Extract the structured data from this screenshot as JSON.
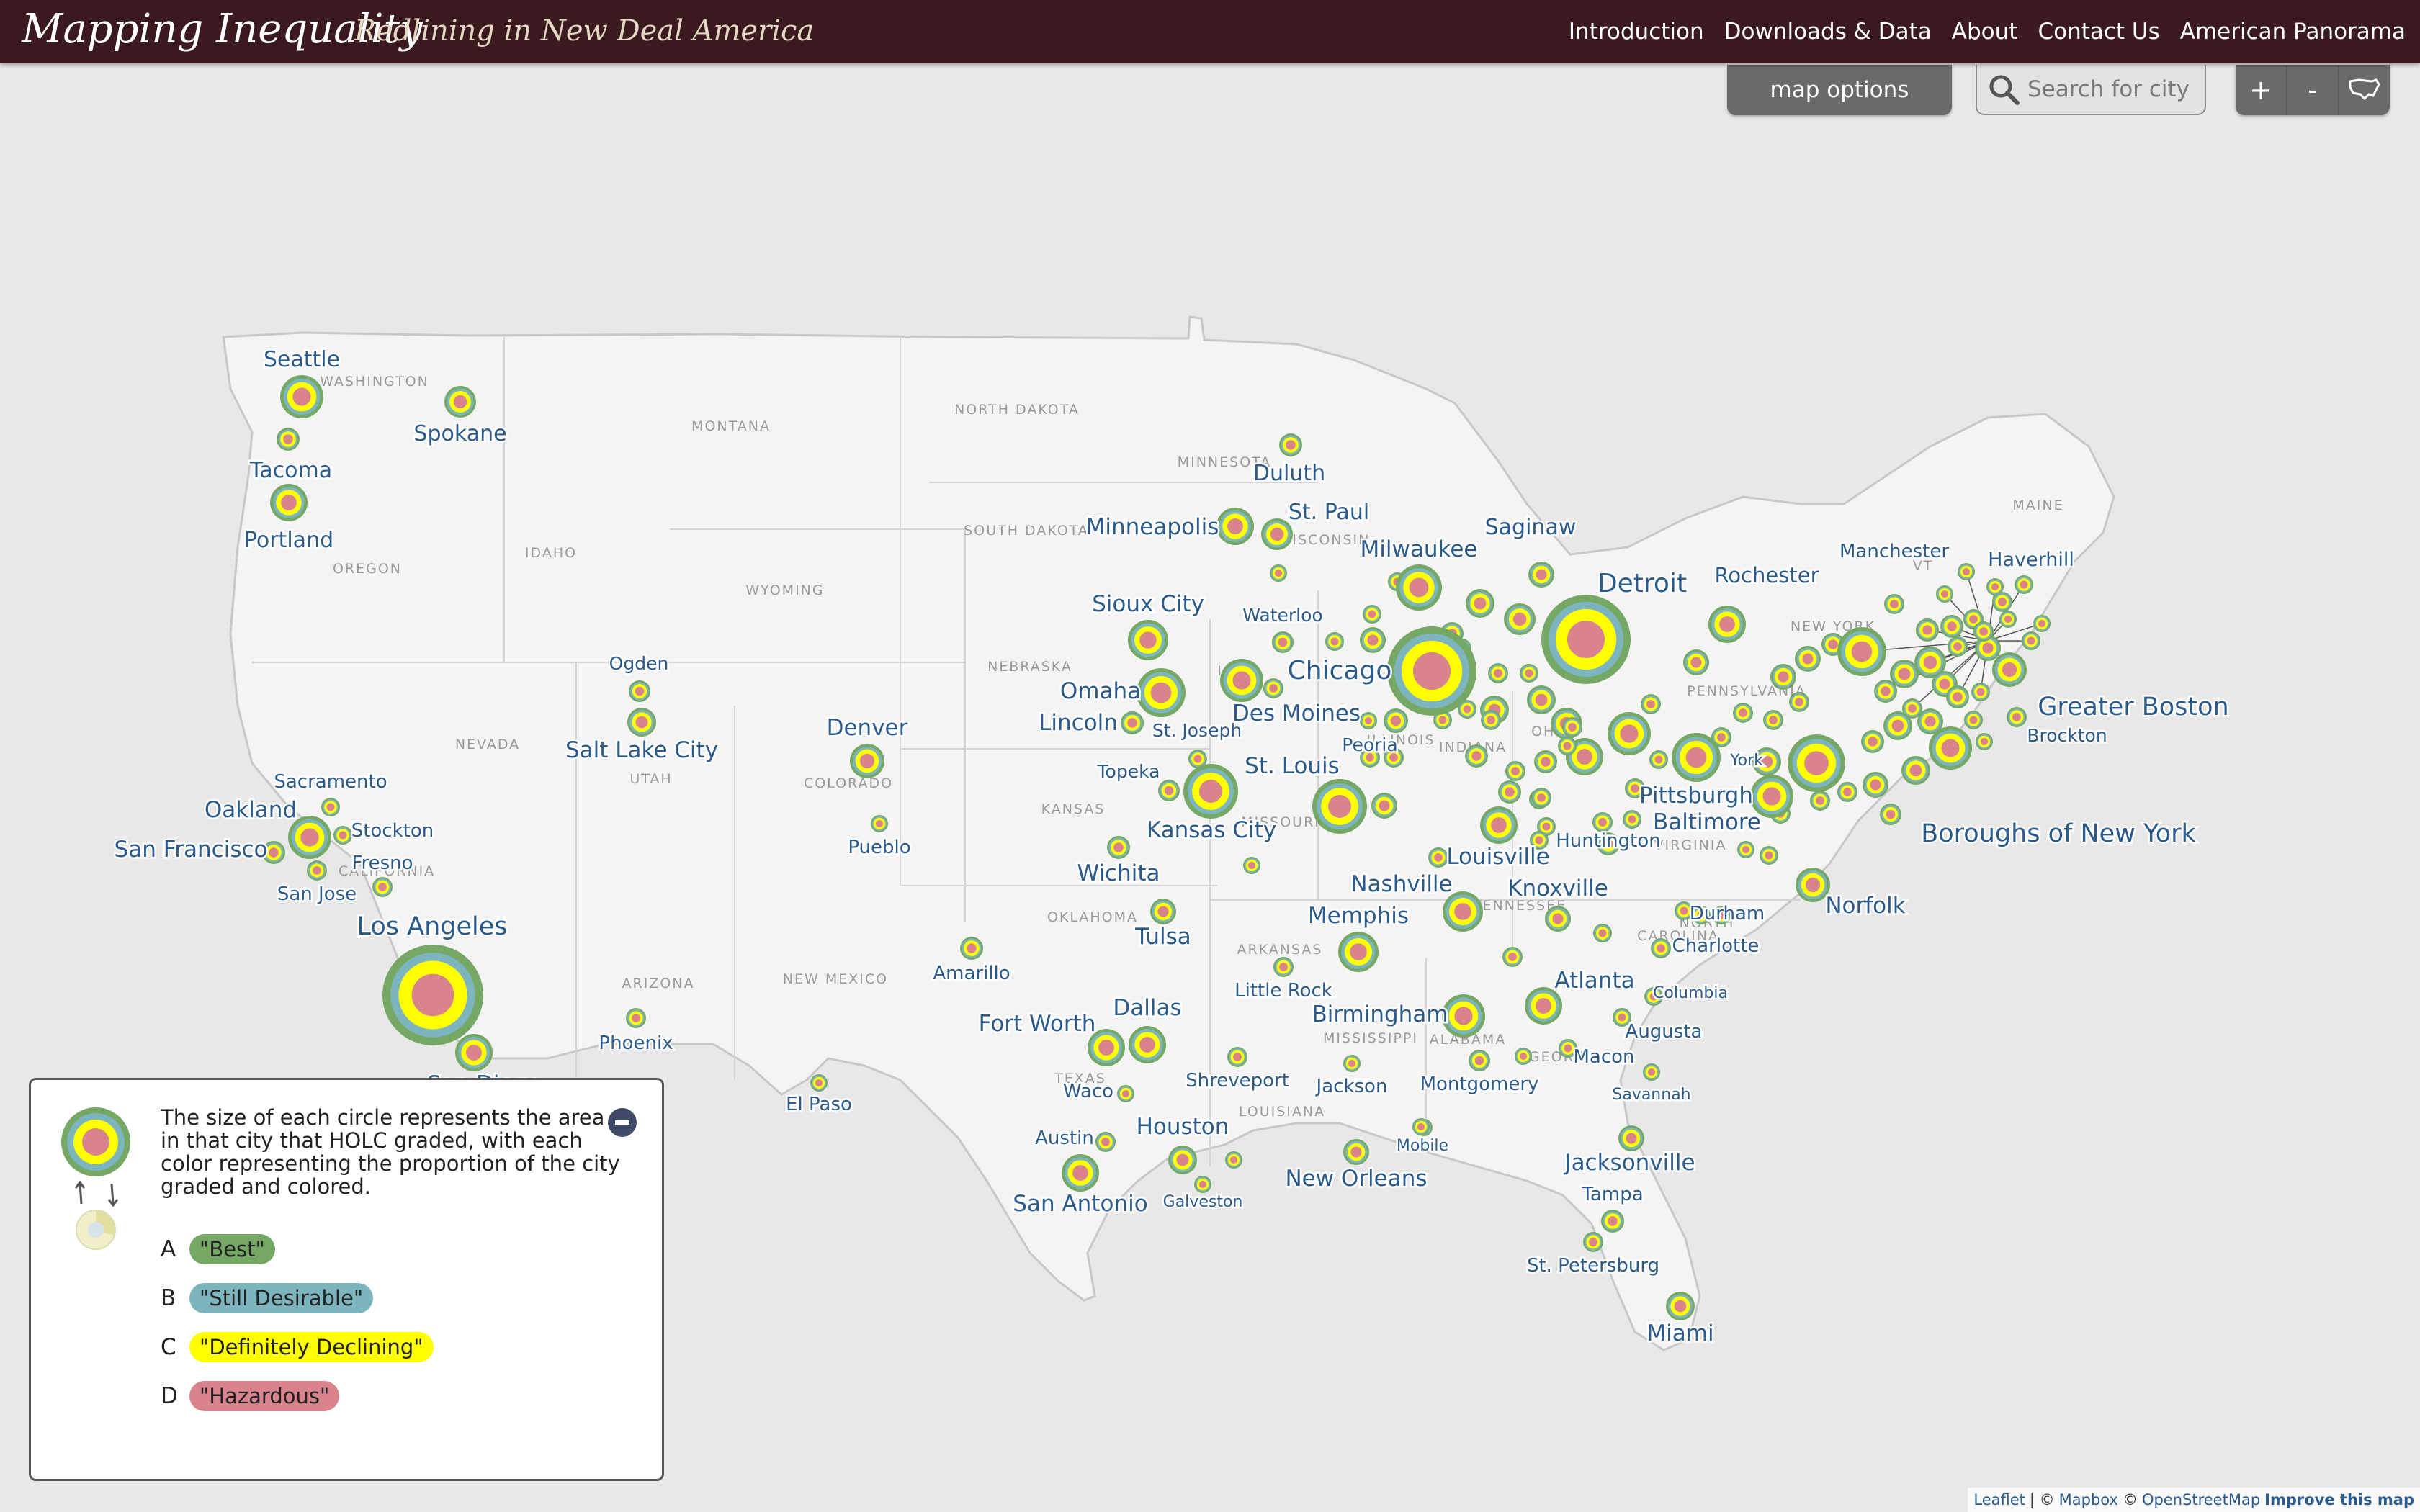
{
  "header": {
    "title": "Mapping Inequality",
    "subtitle": "Redlining in New Deal America",
    "nav": [
      "Introduction",
      "Downloads & Data",
      "About",
      "Contact Us",
      "American Panorama"
    ]
  },
  "controls": {
    "map_options": "map options",
    "search_placeholder": "Search for city",
    "zoom_in": "+",
    "zoom_out": "-",
    "reset_icon": "us-outline-icon"
  },
  "colors": {
    "A": "#76a865",
    "B": "#7cb5bd",
    "C": "#ffff00",
    "D": "#d9838d",
    "label": "#2b5a8c",
    "header_bg": "#3a1a1e"
  },
  "states": [
    "WASHINGTON",
    "MONTANA",
    "NORTH DAKOTA",
    "MINNESOTA",
    "OREGON",
    "IDAHO",
    "WYOMING",
    "SOUTH DAKOTA",
    "WISCONSIN",
    "NEBRASKA",
    "IOWA",
    "NEVADA",
    "UTAH",
    "COLORADO",
    "KANSAS",
    "CALIFORNIA",
    "ARIZONA",
    "NEW MEXICO",
    "OKLAHOMA",
    "TEXAS",
    "ARKANSAS",
    "LOUISIANA",
    "MISSISSIPPI",
    "ALABAMA",
    "MAINE",
    "VT",
    "NEW YORK",
    "NORTH",
    "CAROLINA",
    "TENNESSEE",
    "MISSOURI",
    "VIRGINIA",
    "OHIO",
    "GEORGIA",
    "ILLINOIS",
    "INDIANA",
    "PENNSYLVANIA"
  ],
  "cities": [
    "Seattle",
    "Spokane",
    "Tacoma",
    "Portland",
    "Minneapolis",
    "St. Paul",
    "Duluth",
    "Milwaukee",
    "Saginaw",
    "Detroit",
    "Rochester",
    "Manchester",
    "Haverhill",
    "Sioux City",
    "Waterloo",
    "Chicago",
    "Omaha",
    "Lincoln",
    "Des Moines",
    "St. Joseph",
    "Peoria",
    "Greater Boston",
    "Brockton",
    "Ogden",
    "Salt Lake City",
    "Denver",
    "Pueblo",
    "Topeka",
    "Kansas City",
    "St. Louis",
    "Pittsburgh",
    "York",
    "Baltimore",
    "Huntington",
    "Louisville",
    "Boroughs of New York",
    "Sacramento",
    "Oakland",
    "Stockton",
    "San Francisco",
    "Fresno",
    "San Jose",
    "Wichita",
    "Nashville",
    "Knoxville",
    "Norfolk",
    "Durham",
    "Charlotte",
    "Los Angeles",
    "San Diego",
    "Tulsa",
    "Memphis",
    "Amarillo",
    "Little Rock",
    "Atlanta",
    "Columbia",
    "Augusta",
    "Phoenix",
    "Fort Worth",
    "Dallas",
    "Birmingham",
    "Macon",
    "Shreveport",
    "Waco",
    "Jackson",
    "Montgomery",
    "Savannah",
    "El Paso",
    "Austin",
    "Houston",
    "Mobile",
    "Galveston",
    "San Antonio",
    "New Orleans",
    "Jacksonville",
    "Tampa",
    "St. Petersburg",
    "Miami"
  ],
  "legend": {
    "description": "The size of each circle represents the area in that city that HOLC graded, with each color representing the proportion of the city graded and colored.",
    "grades": [
      {
        "letter": "A",
        "label": "\"Best\"",
        "color": "#76a865"
      },
      {
        "letter": "B",
        "label": "\"Still Desirable\"",
        "color": "#7cb5bd"
      },
      {
        "letter": "C",
        "label": "\"Definitely Declining\"",
        "color": "#ffff00"
      },
      {
        "letter": "D",
        "label": "\"Hazardous\"",
        "color": "#d9838d"
      }
    ],
    "collapse_icon": "minus-circle-icon"
  },
  "attribution": {
    "leaflet": "Leaflet",
    "sep": "| ©",
    "mapbox": "Mapbox",
    "copy": "©",
    "osm": "OpenStreetMap",
    "improve": "Improve this map"
  }
}
